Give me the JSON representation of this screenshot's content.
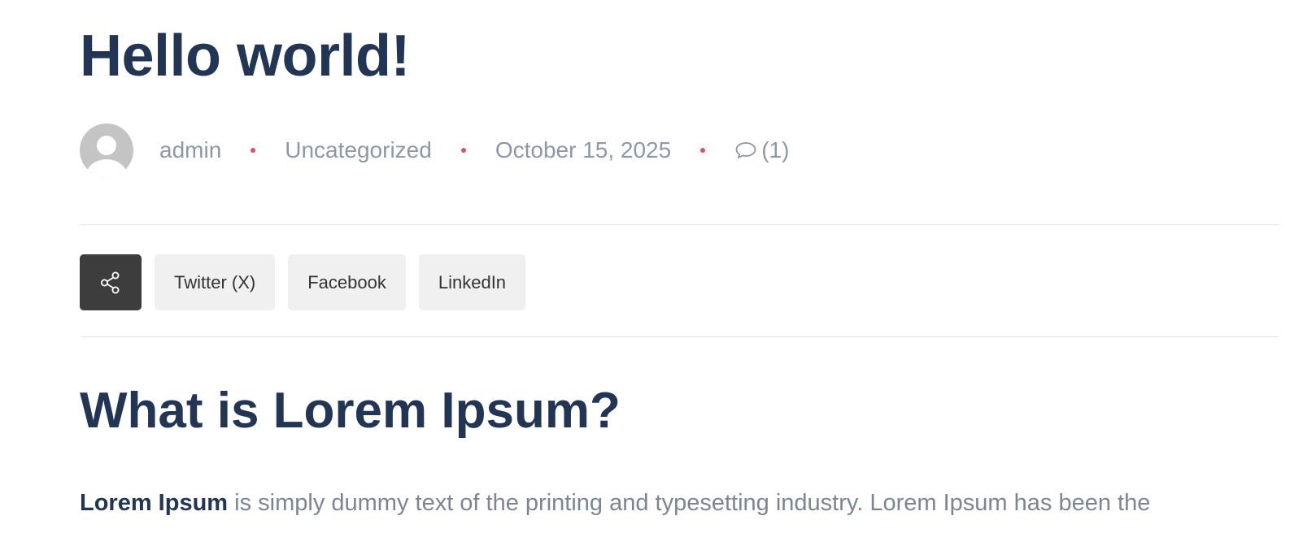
{
  "post": {
    "title": "Hello world!",
    "meta": {
      "author": "admin",
      "category": "Uncategorized",
      "date": "October 15, 2025",
      "comments": "(1)"
    }
  },
  "share": {
    "icon": "share-icon",
    "buttons": [
      "Twitter (X)",
      "Facebook",
      "LinkedIn"
    ]
  },
  "content": {
    "heading": "What is Lorem Ipsum?",
    "paragraph_bold": "Lorem Ipsum",
    "paragraph_text": " is simply dummy text of the printing and typesetting industry. Lorem Ipsum has been the"
  },
  "colors": {
    "title": "#233554",
    "meta_text": "#8e97a8",
    "separator_dot": "#e0506a",
    "share_icon_bg": "#3d3d3d",
    "share_button_bg": "#f0f0f0"
  }
}
